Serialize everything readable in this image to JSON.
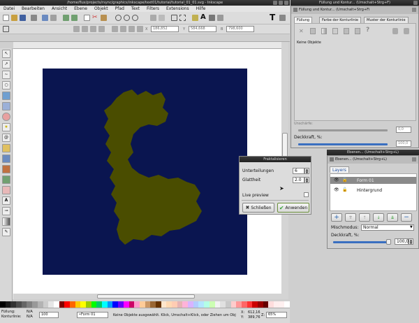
{
  "main_window": {
    "title": "/home/flux/projects/rsync/graphics/inkscape/text01/tutorial/tutorial_01_01.svg - Inkscape"
  },
  "menu": [
    "Datei",
    "Bearbeiten",
    "Ansicht",
    "Ebene",
    "Objekt",
    "Pfad",
    "Text",
    "Filters",
    "Extensions",
    "Hilfe"
  ],
  "coords": {
    "x_label": "X",
    "x_value": "186,852",
    "y_label": "Y",
    "y_value": "584,668",
    "w_label": "B",
    "w_value": "798,600"
  },
  "fill_stroke": {
    "title": "Füllung und Kontur... (Umschalt+Strg+F)",
    "header": "Füllung und Kontur... (Umschalt+Strg+Fi",
    "tabs": [
      "Füllung",
      "Farbe der Konturlinie",
      "Muster der Konturlinie"
    ],
    "no_objects": "Keine Objekte",
    "blur_label": "Unschärfe:",
    "blur_value": "0,0",
    "opacity_label": "Deckkraft, %:",
    "opacity_value": "100,0"
  },
  "fractal_dialog": {
    "title": "Fraktalisieren",
    "subdivisions_label": "Unterteilungen",
    "subdivisions_value": "6",
    "smoothness_label": "Glattheit",
    "smoothness_value": "2.0",
    "live_preview_label": "Live preview",
    "close_label": "Schließen",
    "apply_label": "Anwenden"
  },
  "layers": {
    "title": "Ebenen... (Umschalt+Strg+L)",
    "header": "Ebenen... (Umschalt+Strg+L)",
    "tab": "Layers",
    "items": [
      {
        "name": "Form 01",
        "selected": true
      },
      {
        "name": "Hintergrund",
        "selected": false
      }
    ],
    "blend_label": "Mischmodus:",
    "blend_value": "Normal",
    "opacity_label": "Deckkraft, %:",
    "opacity_value": "100,0"
  },
  "status": {
    "fill_label": "Füllung:",
    "fill_value": "N/A",
    "stroke_label": "Konturlinie:",
    "stroke_value": "N/A",
    "opacity_value": "100",
    "layer_value": "•Form 01",
    "message": "Keine Objekte ausgewählt. Klick, Umschalt+Klick, oder Ziehen um Obj",
    "x_label": "X:",
    "x_value": "612,16",
    "y_label": "Y:",
    "y_value": "389,76",
    "zoom_label": "Z:",
    "zoom_value": "65%"
  },
  "colors": {
    "canvas_bg": "#0a1550",
    "shape": "#4a4d00",
    "accent_green": "#3aa13a"
  },
  "palette": [
    "#000000",
    "#1a1a1a",
    "#333333",
    "#4d4d4d",
    "#666666",
    "#808080",
    "#999999",
    "#b3b3b3",
    "#cccccc",
    "#e6e6e6",
    "#ffffff",
    "#800000",
    "#ff0000",
    "#ff6600",
    "#ffcc00",
    "#ffff00",
    "#99cc00",
    "#00ff00",
    "#00cc66",
    "#00ffff",
    "#0099ff",
    "#0000ff",
    "#6600ff",
    "#ff00ff",
    "#cc0066",
    "#ff99cc",
    "#ffcc99",
    "#cc9966",
    "#996633",
    "#663300",
    "#ffe6cc",
    "#ffd9b3",
    "#ffccb3",
    "#e6b3b3",
    "#ffb3d9",
    "#d9b3ff",
    "#b3ccff",
    "#b3e6ff",
    "#b3ffe6",
    "#ccffb3",
    "#f2f2f2",
    "#e0e0e0",
    "#c8c8c8",
    "#ffcccc",
    "#ff9999",
    "#ff6666",
    "#ff3333",
    "#cc0000",
    "#990000",
    "#660000",
    "#ffdddd",
    "#ffeeee",
    "#fff0f0",
    "#ffffff"
  ]
}
